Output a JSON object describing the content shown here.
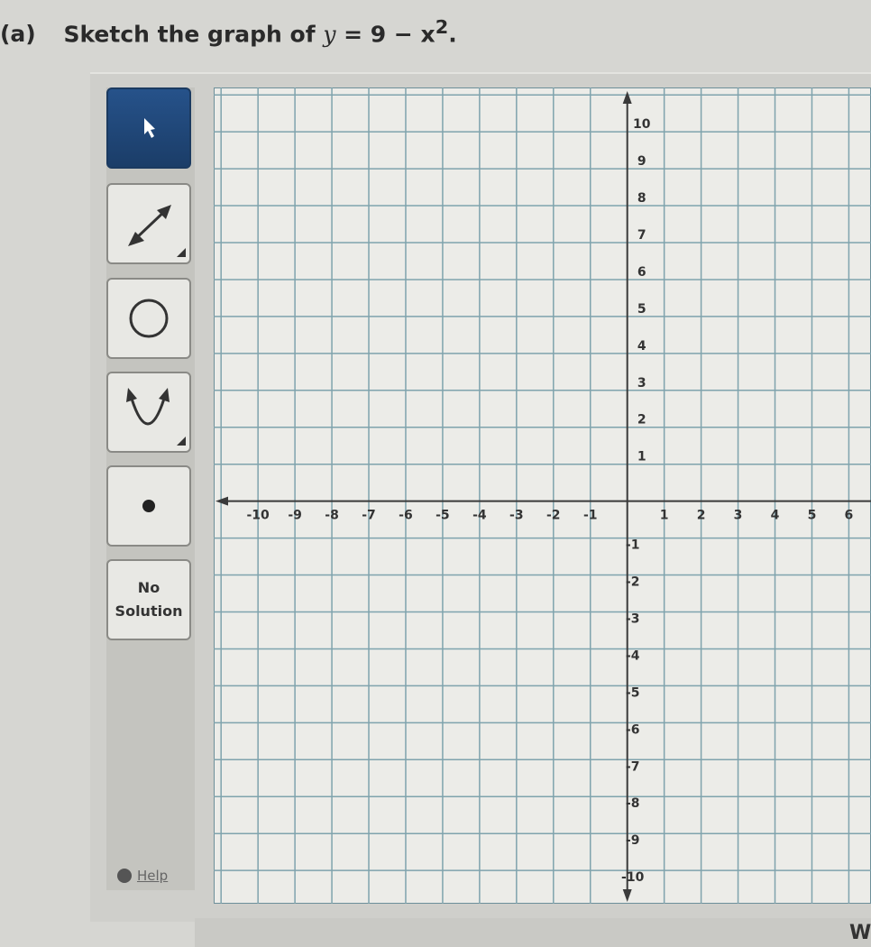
{
  "question": {
    "label": "(a)",
    "text": "Sketch the graph of",
    "equation_lhs": "y",
    "equation_rhs": "= 9 − x",
    "exponent": "2",
    "period": "."
  },
  "toolbar": {
    "tools": [
      {
        "name": "select",
        "icon": "pointer-arrow-icon",
        "active": true
      },
      {
        "name": "line",
        "icon": "double-arrow-line-icon"
      },
      {
        "name": "circle",
        "icon": "circle-icon"
      },
      {
        "name": "parabola",
        "icon": "parabola-icon"
      },
      {
        "name": "point",
        "icon": "point-icon"
      },
      {
        "name": "no-solution",
        "label_line1": "No",
        "label_line2": "Solution"
      }
    ],
    "help_label": "Help"
  },
  "graph": {
    "x_ticks": [
      "-10",
      "-9",
      "-8",
      "-7",
      "-6",
      "-5",
      "-4",
      "-3",
      "-2",
      "-1",
      "1",
      "2",
      "3",
      "4",
      "5",
      "6"
    ],
    "y_ticks": [
      "10",
      "9",
      "8",
      "7",
      "6",
      "5",
      "4",
      "3",
      "2",
      "1",
      "-1",
      "-2",
      "-3",
      "-4",
      "-5",
      "-6",
      "-7",
      "-8",
      "-9",
      "-10"
    ],
    "xlim": [
      -11.2,
      6.6
    ],
    "ylim": [
      -10.9,
      11.2
    ],
    "grid_color": "#7fa3ad",
    "axis_color": "#3a3a3a"
  },
  "footer": {
    "partial_text": "W"
  }
}
